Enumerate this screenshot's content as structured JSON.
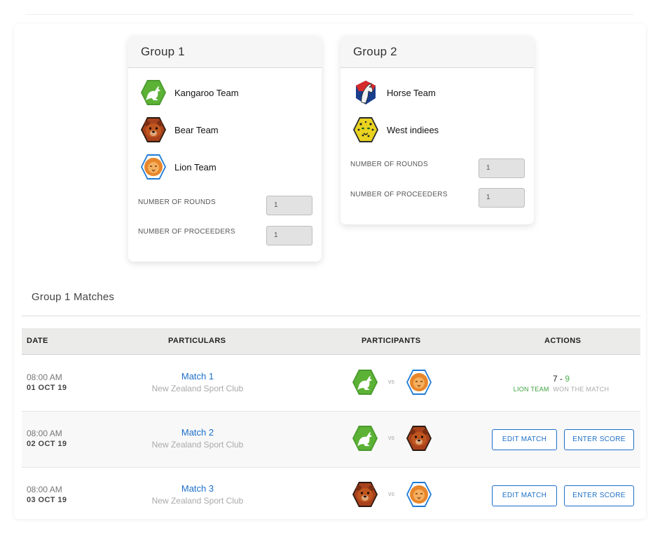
{
  "groups": [
    {
      "title": "Group 1",
      "teams": [
        {
          "name": "Kangaroo Team",
          "icon": "kangaroo-icon"
        },
        {
          "name": "Bear Team",
          "icon": "bear-icon"
        },
        {
          "name": "Lion Team",
          "icon": "lion-icon"
        }
      ],
      "rounds_label": "NUMBER OF ROUNDS",
      "rounds_value": "1",
      "proceeders_label": "NUMBER OF PROCEEDERS",
      "proceeders_value": "1"
    },
    {
      "title": "Group 2",
      "teams": [
        {
          "name": "Horse Team",
          "icon": "horse-icon"
        },
        {
          "name": "West indiees",
          "icon": "leopard-icon"
        }
      ],
      "rounds_label": "NUMBER OF ROUNDS",
      "rounds_value": "1",
      "proceeders_label": "NUMBER OF PROCEEDERS",
      "proceeders_value": "1"
    }
  ],
  "matches_section": {
    "title": "Group 1 Matches",
    "headers": {
      "date": "DATE",
      "particulars": "PARTICULARS",
      "participants": "PARTICIPANTS",
      "actions": "ACTIONS"
    },
    "vs_label": "vs",
    "rows": [
      {
        "time": "08:00 AM",
        "date": "01 OCT 19",
        "match": "Match 1",
        "venue": "New Zealand Sport Club",
        "home_icon": "kangaroo-icon",
        "away_icon": "lion-icon",
        "score_home": "7",
        "score_sep": " - ",
        "score_away": "9",
        "winner": "LION TEAM",
        "won_text": "WON THE MATCH"
      },
      {
        "time": "08:00 AM",
        "date": "02 OCT 19",
        "match": "Match 2",
        "venue": "New Zealand Sport Club",
        "home_icon": "kangaroo-icon",
        "away_icon": "bear-icon",
        "edit_label": "EDIT MATCH",
        "score_label": "ENTER SCORE"
      },
      {
        "time": "08:00 AM",
        "date": "03 OCT 19",
        "match": "Match 3",
        "venue": "New Zealand Sport Club",
        "home_icon": "bear-icon",
        "away_icon": "lion-icon",
        "edit_label": "EDIT MATCH",
        "score_label": "ENTER SCORE"
      }
    ]
  },
  "colors": {
    "accent": "#1c6fc9",
    "win": "#4caf50",
    "header_bg": "#ebebe9"
  }
}
